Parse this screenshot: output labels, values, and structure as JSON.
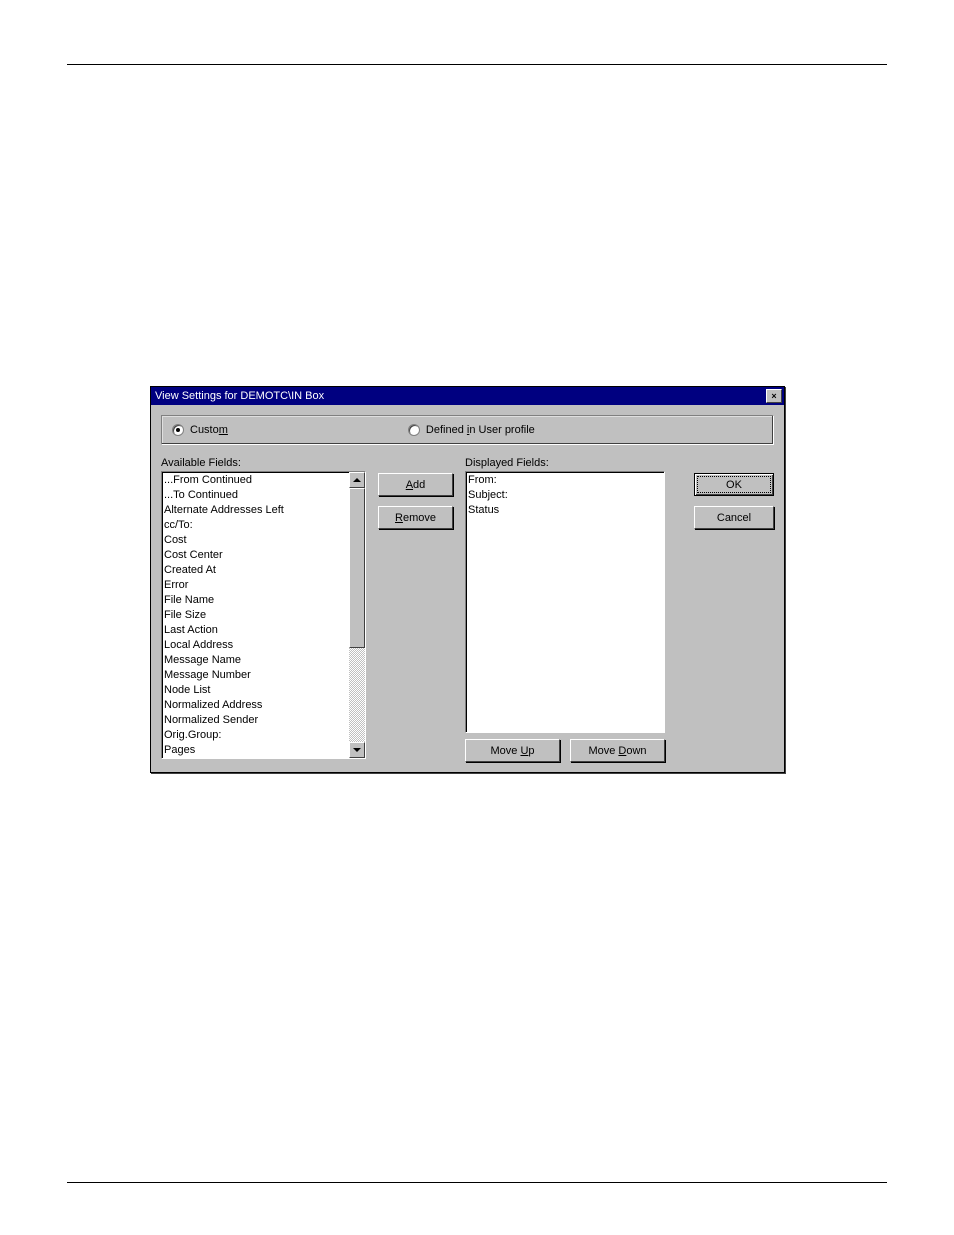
{
  "dialog": {
    "title": "View Settings for DEMOTC\\IN Box",
    "close_icon": "×"
  },
  "radios": {
    "custom": {
      "label_pre": "Custo",
      "label_u": "m",
      "label_post": "",
      "checked": true
    },
    "profile": {
      "label_pre": "Defined ",
      "label_u": "i",
      "label_post": "n User profile",
      "checked": false
    }
  },
  "available": {
    "label": "Available Fields:",
    "items": [
      "...From Continued",
      "...To Continued",
      "Alternate Addresses Left",
      "cc/To:",
      "Cost",
      "Cost Center",
      "Created At",
      "Error",
      "File Name",
      "File Size",
      "Last Action",
      "Local Address",
      "Message Name",
      "Message Number",
      "Node List",
      "Normalized Address",
      "Normalized Sender",
      "Orig.Group:",
      "Pages"
    ]
  },
  "displayed": {
    "label": "Displayed Fields:",
    "items": [
      "From:",
      "Subject:",
      "Status"
    ]
  },
  "buttons": {
    "add": {
      "u": "A",
      "rest": "dd"
    },
    "remove": {
      "u": "R",
      "rest": "emove"
    },
    "ok": "OK",
    "cancel": "Cancel",
    "move_up": {
      "pre": "Move ",
      "u": "U",
      "post": "p"
    },
    "move_down": {
      "pre": "Move ",
      "u": "D",
      "post": "own"
    }
  }
}
